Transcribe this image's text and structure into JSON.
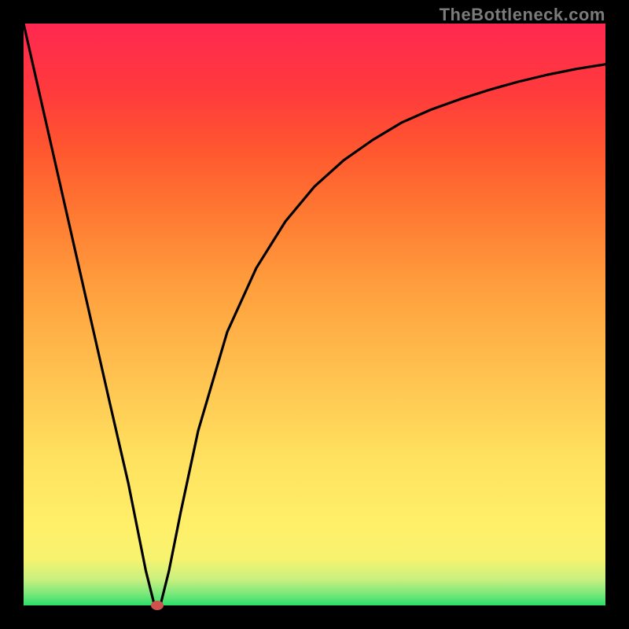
{
  "branding": {
    "text": "TheBottleneck.com"
  },
  "chart_data": {
    "type": "line",
    "title": "",
    "xlabel": "",
    "ylabel": "",
    "xlim": [
      0,
      100
    ],
    "ylim": [
      0,
      100
    ],
    "grid": false,
    "legend": false,
    "background": "rainbow-vertical",
    "series": [
      {
        "name": "bottleneck-curve",
        "x": [
          0,
          5,
          10,
          15,
          18,
          20,
          21,
          22,
          22.5,
          23.5,
          25,
          27,
          30,
          35,
          40,
          45,
          50,
          55,
          60,
          65,
          70,
          75,
          80,
          85,
          90,
          95,
          100
        ],
        "values": [
          100,
          78,
          56,
          34,
          21,
          11,
          6,
          2,
          0,
          0,
          6,
          16,
          30,
          47,
          58,
          66,
          72,
          76.5,
          80,
          83,
          85.2,
          87,
          88.6,
          90,
          91.2,
          92.2,
          93
        ]
      }
    ],
    "marker": {
      "name": "min-point",
      "x": 23,
      "y": 0,
      "color": "#d0524e"
    }
  }
}
